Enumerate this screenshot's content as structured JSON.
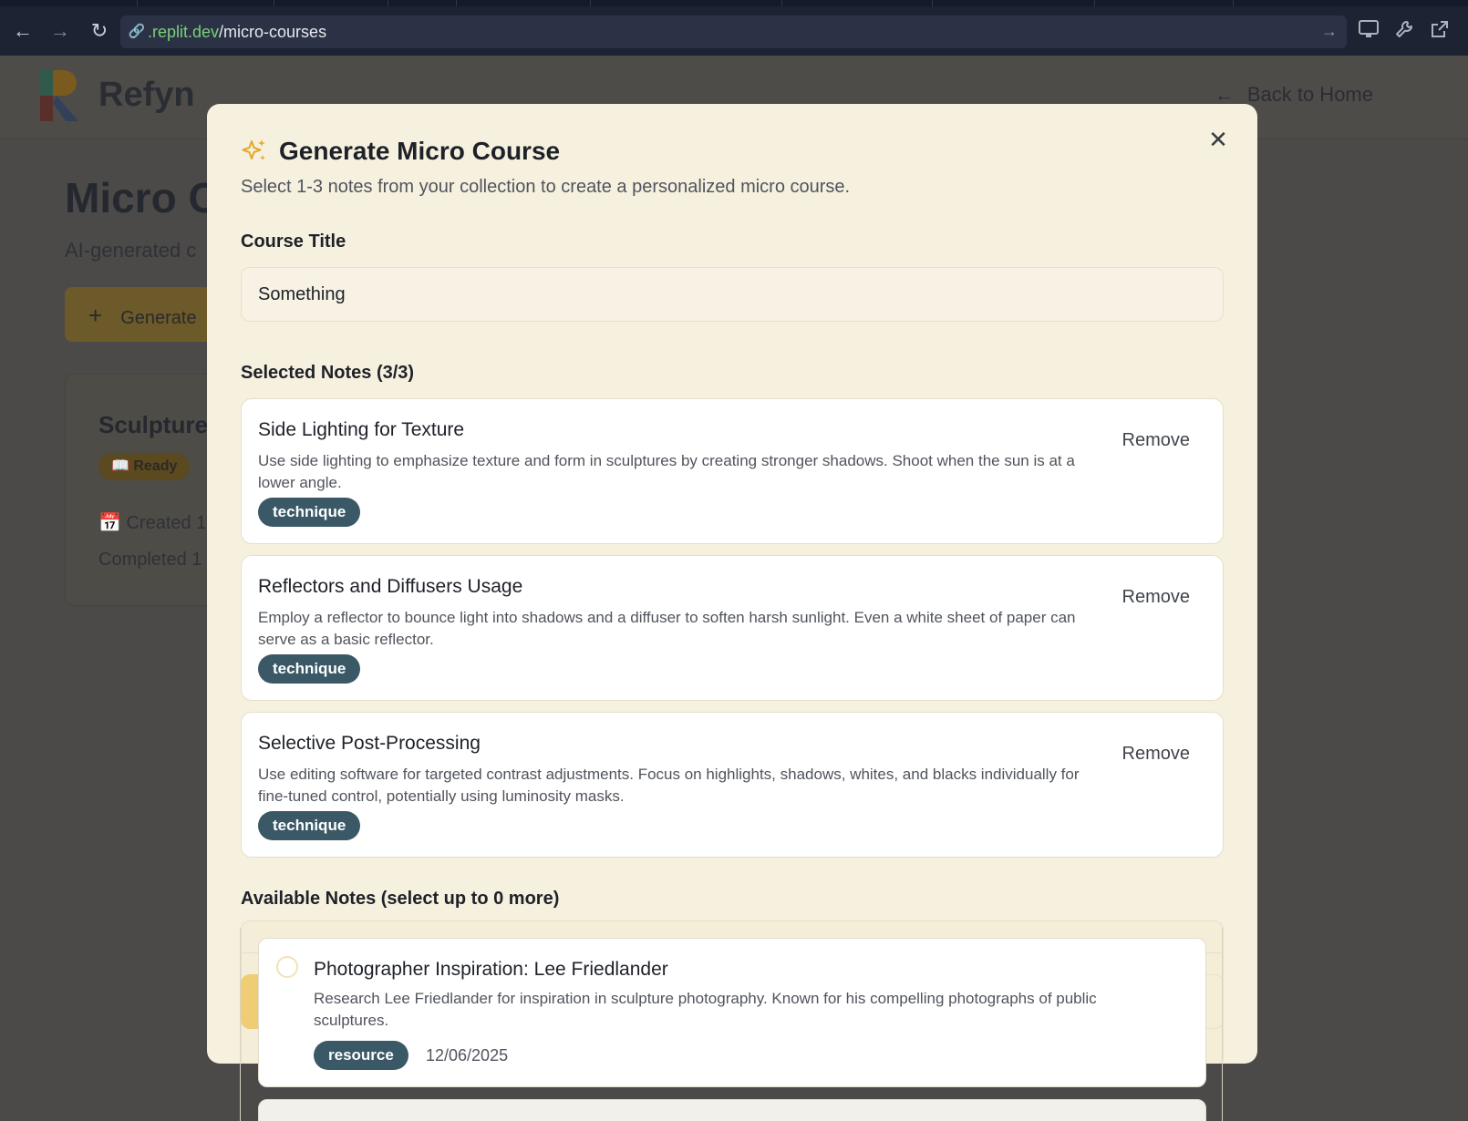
{
  "browser": {
    "url_host": ".replit.dev",
    "url_path": "/micro-courses",
    "icons": [
      "back-arrow-icon",
      "forward-arrow-icon",
      "reload-icon",
      "link-icon",
      "go-arrow-icon",
      "monitor-icon",
      "wrench-icon",
      "external-link-icon"
    ]
  },
  "app": {
    "brand": "Refyn",
    "back_home": "Back to Home",
    "page_title": "Micro C",
    "page_subtitle": "AI-generated c",
    "generate_button": "Generate",
    "course_card": {
      "title": "Sculpture",
      "status": "Ready",
      "created": "Created 1",
      "completed": "Completed 1"
    }
  },
  "modal": {
    "title": "Generate Micro Course",
    "description": "Select 1-3 notes from your collection to create a personalized micro course.",
    "course_title_label": "Course Title",
    "course_title_value": "Something",
    "selected_label": "Selected Notes (3/3)",
    "remove_label": "Remove",
    "selected_notes": [
      {
        "title": "Side Lighting for Texture",
        "body": "Use side lighting to emphasize texture and form in sculptures by creating stronger shadows. Shoot when the sun is at a lower angle.",
        "tag": "technique"
      },
      {
        "title": "Reflectors and Diffusers Usage",
        "body": "Employ a reflector to bounce light into shadows and a diffuser to soften harsh sunlight. Even a white sheet of paper can serve as a basic reflector.",
        "tag": "technique"
      },
      {
        "title": "Selective Post-Processing",
        "body": "Use editing software for targeted contrast adjustments. Focus on highlights, shadows, whites, and blacks individually for fine-tuned control, potentially using luminosity masks.",
        "tag": "technique"
      }
    ],
    "available_label": "Available Notes (select up to 0 more)",
    "available_notes": [
      {
        "title": "Photographer Inspiration: Lee Friedlander",
        "body": "Research Lee Friedlander for inspiration in sculpture photography. Known for his compelling photographs of public sculptures.",
        "tag": "resource",
        "date": "12/06/2025"
      }
    ]
  },
  "colors": {
    "modal_bg": "#f6f0df",
    "tag_bg": "#3a5866",
    "accent_gold": "#efcd74",
    "overlay": "#4b4a48"
  }
}
